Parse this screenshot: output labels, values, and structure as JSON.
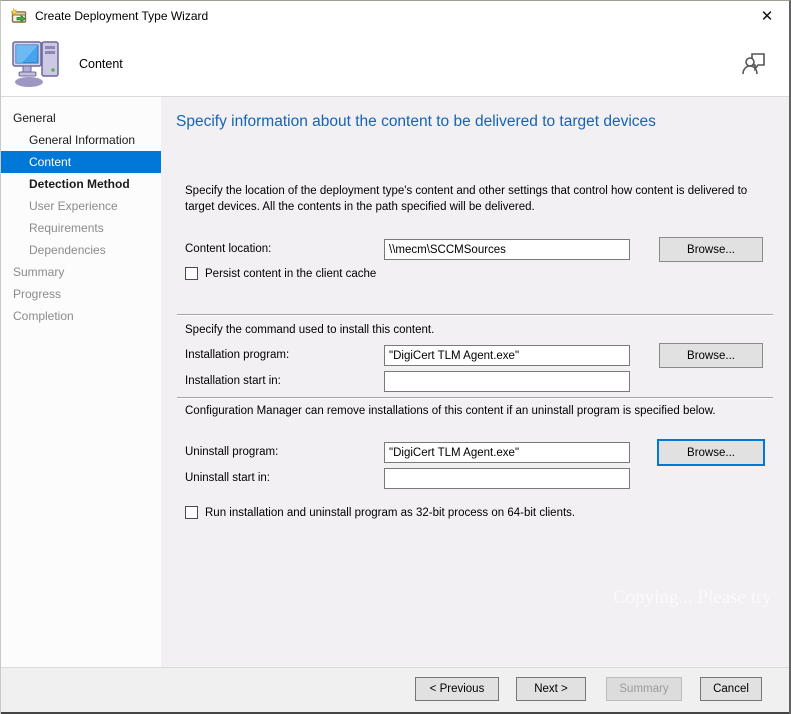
{
  "window": {
    "title": "Create Deployment Type Wizard",
    "close_glyph": "✕"
  },
  "header": {
    "page_title": "Content"
  },
  "sidebar": {
    "items": [
      {
        "label": "General"
      },
      {
        "label": "General Information"
      },
      {
        "label": "Content"
      },
      {
        "label": "Detection Method"
      },
      {
        "label": "User Experience"
      },
      {
        "label": "Requirements"
      },
      {
        "label": "Dependencies"
      },
      {
        "label": "Summary"
      },
      {
        "label": "Progress"
      },
      {
        "label": "Completion"
      }
    ]
  },
  "main": {
    "heading": "Specify information about the content to be delivered to target devices",
    "intro": "Specify the location of the deployment type's content and other settings that control how content is delivered to target devices. All the contents in the path specified will be delivered.",
    "content_location": {
      "label": "Content location:",
      "value": "\\\\mecm\\SCCMSources",
      "browse_label": "Browse..."
    },
    "persist_checkbox_label": "Persist content in the client cache",
    "install_section_text": "Specify the command used to install this content.",
    "installation_program": {
      "label": "Installation program:",
      "value": "\"DigiCert TLM Agent.exe\"",
      "browse_label": "Browse..."
    },
    "installation_start_in": {
      "label": "Installation start in:",
      "value": ""
    },
    "uninstall_section_text": "Configuration Manager can remove installations of this content if an uninstall program is specified below.",
    "uninstall_program": {
      "label": "Uninstall program:",
      "value": "\"DigiCert TLM Agent.exe\"",
      "browse_label": "Browse..."
    },
    "uninstall_start_in": {
      "label": "Uninstall start in:",
      "value": ""
    },
    "run32bit_checkbox_label": "Run installation and uninstall program as 32-bit process on 64-bit clients.",
    "watermark": "Copying... Please try"
  },
  "footer": {
    "previous_label": "< Previous",
    "next_label": "Next >",
    "summary_label": "Summary",
    "cancel_label": "Cancel"
  },
  "colors": {
    "accent_blue": "#0078d7",
    "heading_blue": "#1464b4"
  }
}
